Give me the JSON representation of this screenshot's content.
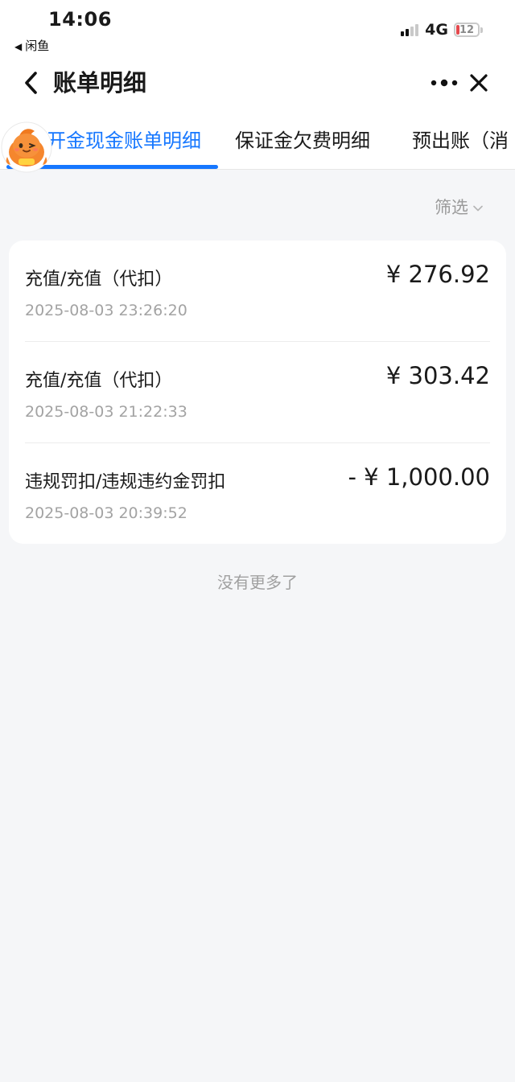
{
  "status_bar": {
    "time": "14:06",
    "back_app": "闲鱼",
    "network": "4G",
    "battery": "12"
  },
  "nav": {
    "title": "账单明细"
  },
  "tabs": [
    {
      "label": "开金现金账单明细",
      "active": true
    },
    {
      "label": "保证金欠费明细",
      "active": false
    },
    {
      "label": "预出账（消",
      "active": false
    }
  ],
  "filter": {
    "label": "筛选"
  },
  "bills": [
    {
      "title": "充值/充值（代扣）",
      "amount": "¥ 276.92",
      "time": "2025-08-03 23:26:20"
    },
    {
      "title": "充值/充值（代扣）",
      "amount": "¥ 303.42",
      "time": "2025-08-03 21:22:33"
    },
    {
      "title": "违规罚扣/违规违约金罚扣",
      "amount": "- ¥ 1,000.00",
      "time": "2025-08-03 20:39:52"
    }
  ],
  "footer": {
    "no_more": "没有更多了"
  },
  "colors": {
    "accent": "#1677ff",
    "page_bg": "#f5f6f8",
    "card_bg": "#ffffff",
    "muted_text": "#a3a3a3",
    "battery_low": "#e5484d",
    "mascot": "#f5862d"
  }
}
